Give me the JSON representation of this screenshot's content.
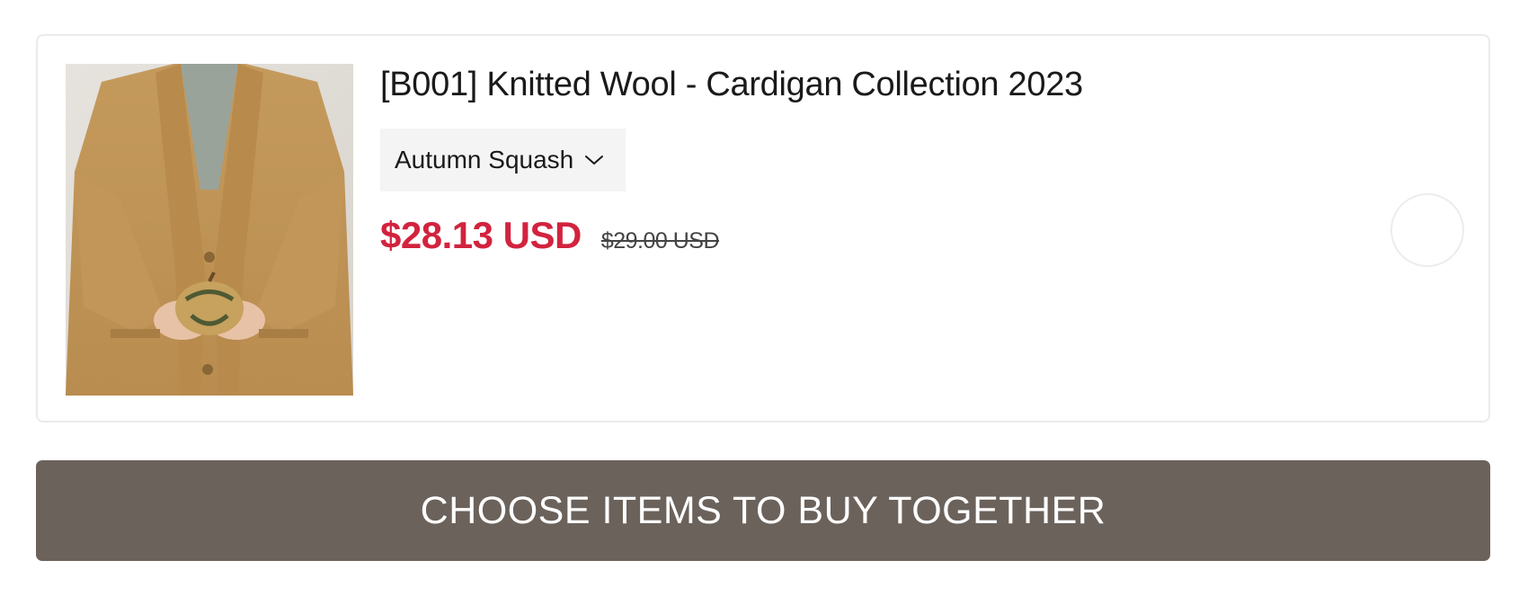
{
  "product": {
    "title": "[B001] Knitted Wool - Cardigan Collection 2023",
    "image_icon": "product-photo-cardigan",
    "variant": {
      "selected": "Autumn Squash",
      "icon": "chevron-down-icon"
    },
    "price": "$28.13 USD",
    "compare_at_price": "$29.00 USD",
    "selected": false
  },
  "cta": {
    "label": "CHOOSE ITEMS TO BUY TOGETHER"
  },
  "colors": {
    "price": "#d2233e",
    "cta_background": "#6b625b",
    "variant_background": "#f4f4f4",
    "card_border": "#ecebe8"
  }
}
